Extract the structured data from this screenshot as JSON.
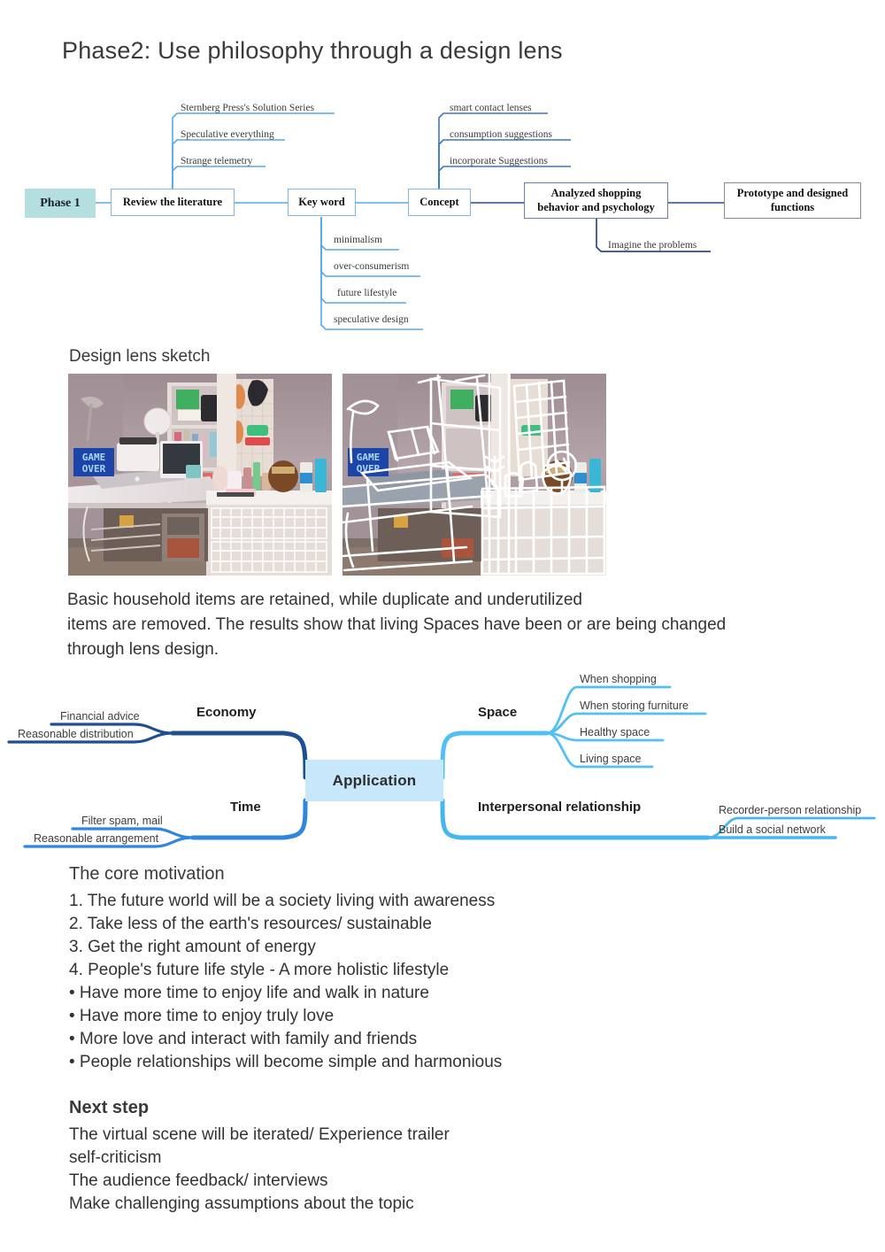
{
  "title": "Phase2: Use philosophy through a design lens",
  "flowchart": {
    "phase_label": "Phase 1",
    "nodes": [
      {
        "id": "review",
        "label": "Review the literature"
      },
      {
        "id": "keyword",
        "label": "Key word"
      },
      {
        "id": "concept",
        "label": "Concept"
      },
      {
        "id": "analyzed",
        "label": "Analyzed  shopping behavior and psychology"
      },
      {
        "id": "prototype",
        "label": "Prototype and designed functions"
      }
    ],
    "review_leaves": [
      "Sternberg Press's Solution Series",
      "Speculative everything",
      "Strange telemetry"
    ],
    "keyword_leaves": [
      "minimalism",
      "over-consumerism",
      "future lifestyle",
      "speculative design"
    ],
    "concept_leaves": [
      "smart contact lenses",
      "consumption suggestions",
      "incorporate Suggestions"
    ],
    "analyzed_leaves": [
      "Imagine the problems"
    ],
    "colors": {
      "phase_fill": "#b5dedf",
      "line_light": "#56a8e8",
      "line_dark": "#2c4a8a",
      "box_border": "#6d7fa8"
    }
  },
  "sketch": {
    "label": "Design lens sketch",
    "photo_left_alt": "cluttered-desk-photo",
    "photo_right_alt": "cluttered-desk-photo-with-white-wireframe-overlay",
    "sign_text_line1": "GAME",
    "sign_text_line2": "OVER"
  },
  "paragraph": {
    "lines": [
      "Basic household items are retained, while duplicate and underutilized",
      "items are removed. The results show that living Spaces have been or are being changed",
      "through lens design."
    ]
  },
  "mindmap": {
    "center": "Application",
    "colors": {
      "center_fill": "#c7e7fb",
      "economy": "#1d4f91",
      "time": "#2f87dd",
      "space": "#53c0f5",
      "interpersonal": "#45b6f2"
    },
    "branches": [
      {
        "name": "Economy",
        "side": "left",
        "leaves": [
          "Financial advice",
          "Reasonable distribution"
        ]
      },
      {
        "name": "Time",
        "side": "left",
        "leaves": [
          "Filter spam, mail",
          "Reasonable arrangement"
        ]
      },
      {
        "name": "Space",
        "side": "right",
        "leaves": [
          "When shopping",
          "When storing furniture",
          "Healthy space",
          "Living space"
        ]
      },
      {
        "name": "Interpersonal relationship",
        "side": "right",
        "leaves": [
          "Recorder-person relationship",
          "Build a social network"
        ]
      }
    ]
  },
  "core_motivation": {
    "heading": "The core motivation",
    "items": [
      "1. The future world will be a society living with awareness",
      "2. Take less of the earth's resources/ sustainable",
      "3. Get the right amount of energy",
      "4. People's future life style - A more holistic lifestyle",
      "• Have more time to enjoy life and walk in nature",
      "• Have more time to enjoy truly love",
      "• More love and interact with family and friends",
      "• People relationships will become simple and harmonious"
    ]
  },
  "next_step": {
    "heading": "Next step",
    "items": [
      "The virtual scene will be iterated/ Experience trailer",
      "self-criticism",
      "The audience feedback/ interviews",
      "Make challenging assumptions about the topic"
    ]
  }
}
